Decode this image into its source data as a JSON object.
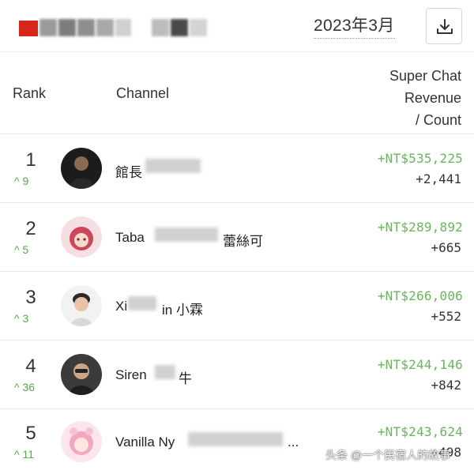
{
  "header": {
    "date": "2023年3月",
    "download_icon": "download-icon"
  },
  "columns": {
    "rank": "Rank",
    "channel": "Channel",
    "revenue_line1": "Super Chat",
    "revenue_line2": "Revenue",
    "revenue_line3": "/ Count"
  },
  "rows": [
    {
      "rank": "1",
      "change": "9",
      "name": "館長",
      "amount": "+NT$535,225",
      "count": "+2,441"
    },
    {
      "rank": "2",
      "change": "5",
      "name": "Taba",
      "name_suffix": "蕾絲可",
      "amount": "+NT$289,892",
      "count": "+665"
    },
    {
      "rank": "3",
      "change": "3",
      "name": "Xi",
      "name_suffix": "in 小霖",
      "amount": "+NT$266,006",
      "count": "+552"
    },
    {
      "rank": "4",
      "change": "36",
      "name": "Siren",
      "name_suffix": "牛",
      "amount": "+NT$244,146",
      "count": "+842"
    },
    {
      "rank": "5",
      "change": "11",
      "name": "Vanilla Ny",
      "name_suffix": "...",
      "amount": "+NT$243,624",
      "count": "+498"
    }
  ],
  "watermark": "头条 @一个民宿人的故事",
  "colors": {
    "positive": "#6bb35e",
    "logo_red": "#d9241c"
  }
}
